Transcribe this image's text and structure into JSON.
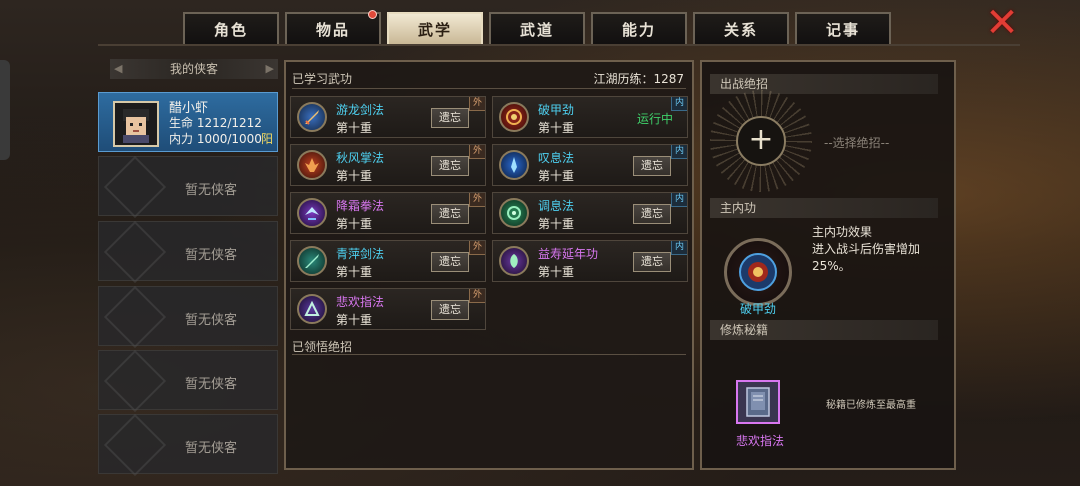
{
  "tabs": [
    {
      "label": "角色",
      "active": false,
      "badge": false
    },
    {
      "label": "物品",
      "active": false,
      "badge": true
    },
    {
      "label": "武学",
      "active": true,
      "badge": false
    },
    {
      "label": "武道",
      "active": false,
      "badge": false
    },
    {
      "label": "能力",
      "active": false,
      "badge": false
    },
    {
      "label": "关系",
      "active": false,
      "badge": false
    },
    {
      "label": "记事",
      "active": false,
      "badge": false
    }
  ],
  "close_icon": "close-x-icon",
  "heroes": {
    "header": "我的侠客",
    "active": {
      "name": "醋小虾",
      "hp": "生命 1212/1212",
      "mp": "内力 1000/1000",
      "yang": "阳"
    },
    "empty_label": "暂无侠客",
    "empty_count": 5
  },
  "skills_panel": {
    "title": "已学习武功",
    "experience": "江湖历练：1287",
    "learned_ultimates": "已领悟绝招",
    "forget_label": "遗忘",
    "running_label": "运行中",
    "skills": [
      {
        "name": "游龙剑法",
        "level": "第十重",
        "type": "外",
        "color": "blue",
        "status": "forget",
        "icon": "sword-icon"
      },
      {
        "name": "破甲劲",
        "level": "第十重",
        "type": "内",
        "color": "blue",
        "status": "running",
        "icon": "armor-break-icon"
      },
      {
        "name": "秋风掌法",
        "level": "第十重",
        "type": "外",
        "color": "blue",
        "status": "forget",
        "icon": "palm-icon"
      },
      {
        "name": "叹息法",
        "level": "第十重",
        "type": "内",
        "color": "blue",
        "status": "forget",
        "icon": "sigh-icon"
      },
      {
        "name": "降霜拳法",
        "level": "第十重",
        "type": "外",
        "color": "purple",
        "status": "forget",
        "icon": "fist-icon"
      },
      {
        "name": "调息法",
        "level": "第十重",
        "type": "内",
        "color": "blue",
        "status": "forget",
        "icon": "breath-icon"
      },
      {
        "name": "青萍剑法",
        "level": "第十重",
        "type": "外",
        "color": "blue",
        "status": "forget",
        "icon": "sword-icon"
      },
      {
        "name": "益寿延年功",
        "level": "第十重",
        "type": "内",
        "color": "purple",
        "status": "forget",
        "icon": "longevity-icon"
      },
      {
        "name": "悲欢指法",
        "level": "第十重",
        "type": "外",
        "color": "purple",
        "status": "forget",
        "icon": "finger-icon"
      }
    ]
  },
  "right_panel": {
    "ultimate_header": "出战绝招",
    "choose_text": "--选择绝招--",
    "inner_header": "主内功",
    "inner_name": "破甲劲",
    "inner_effect_title": "主内功效果",
    "inner_effect_desc": "进入战斗后伤害增加25%。",
    "book_header": "修炼秘籍",
    "book_name": "悲欢指法",
    "book_note": "秘籍已修炼至最高重"
  },
  "colors": {
    "blue": "#4ed0f0",
    "purple": "#d877f0",
    "running": "#3fd06a",
    "close": "#e23d35"
  }
}
